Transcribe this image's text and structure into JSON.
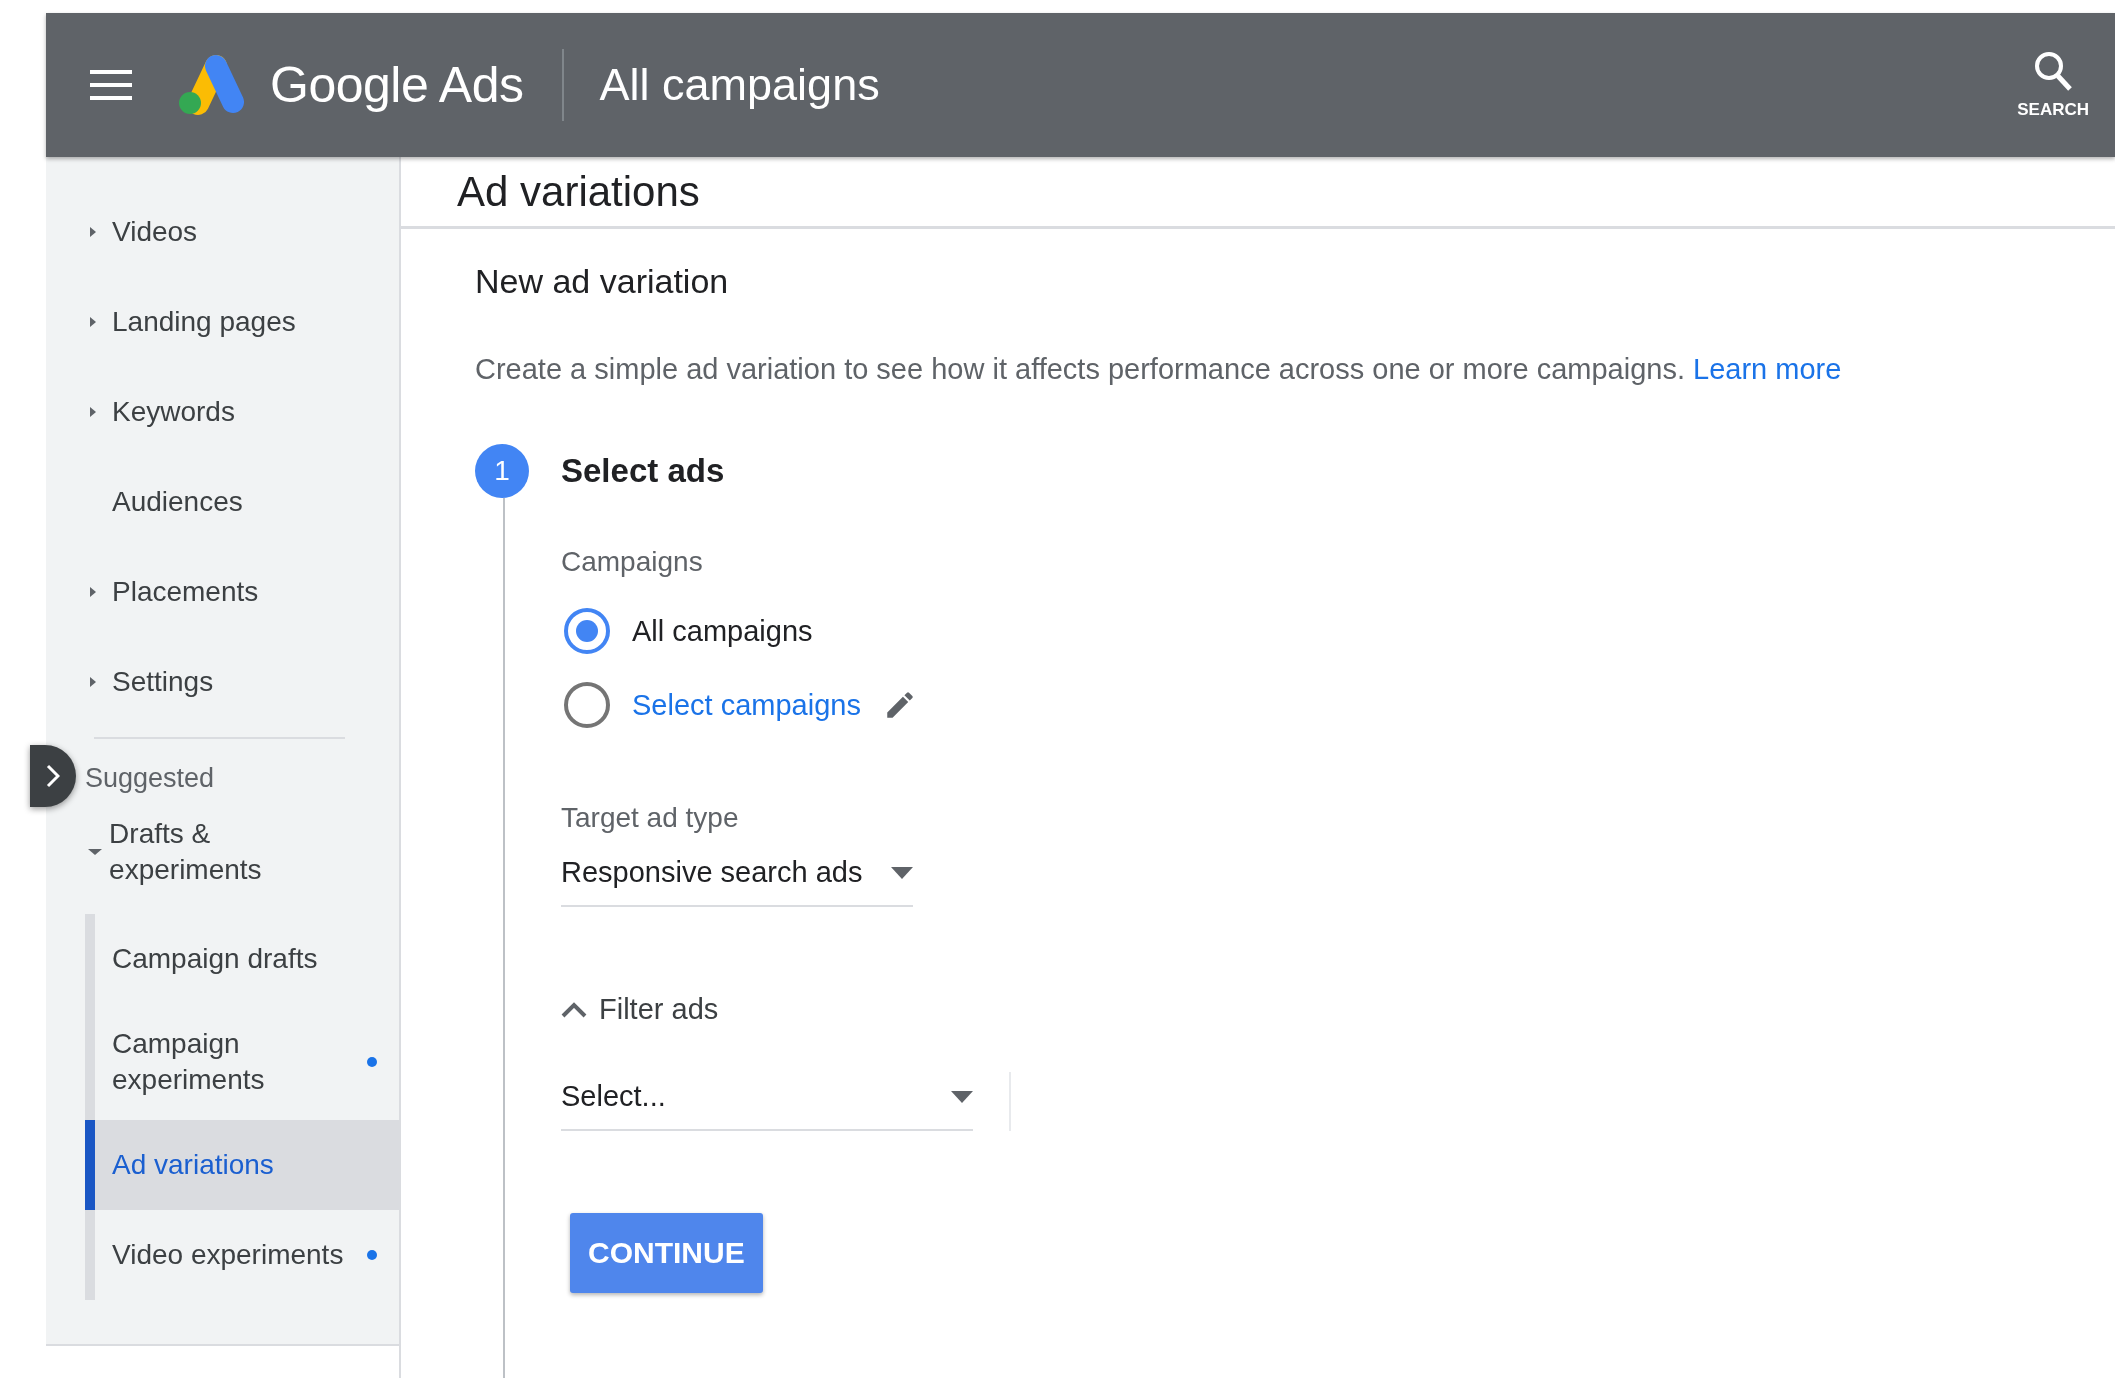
{
  "header": {
    "product": "Google Ads",
    "title": "All campaigns",
    "search_label": "SEARCH"
  },
  "sidebar": {
    "items": [
      {
        "label": "Videos",
        "kind": "group",
        "expanded": false
      },
      {
        "label": "Landing pages",
        "kind": "group",
        "expanded": false
      },
      {
        "label": "Keywords",
        "kind": "group",
        "expanded": false
      },
      {
        "label": "Audiences",
        "kind": "link"
      },
      {
        "label": "Placements",
        "kind": "group",
        "expanded": false
      },
      {
        "label": "Settings",
        "kind": "group",
        "expanded": false
      }
    ],
    "section": "Suggested",
    "groups": [
      {
        "label": "Drafts & experiments",
        "expanded": true,
        "children": [
          {
            "label": "Campaign drafts",
            "selected": false,
            "dot": false
          },
          {
            "label": "Campaign experiments",
            "selected": false,
            "dot": true
          },
          {
            "label": "Ad variations",
            "selected": true,
            "dot": false
          },
          {
            "label": "Video experiments",
            "selected": false,
            "dot": true
          }
        ]
      }
    ]
  },
  "page_title": "Ad variations",
  "form": {
    "heading": "New ad variation",
    "description": "Create a simple ad variation to see how it affects performance across one or more campaigns.",
    "learn_more": "Learn more",
    "step": {
      "number": "1",
      "title": "Select ads"
    },
    "campaigns_label": "Campaigns",
    "radios": [
      {
        "label": "All campaigns",
        "selected": true,
        "kind": "text"
      },
      {
        "label": "Select campaigns",
        "selected": false,
        "kind": "link"
      }
    ],
    "target_label": "Target ad type",
    "target_value": "Responsive search ads",
    "filter": {
      "label": "Filter ads",
      "expanded": true,
      "value": "Select..."
    },
    "continue": "CONTINUE"
  }
}
